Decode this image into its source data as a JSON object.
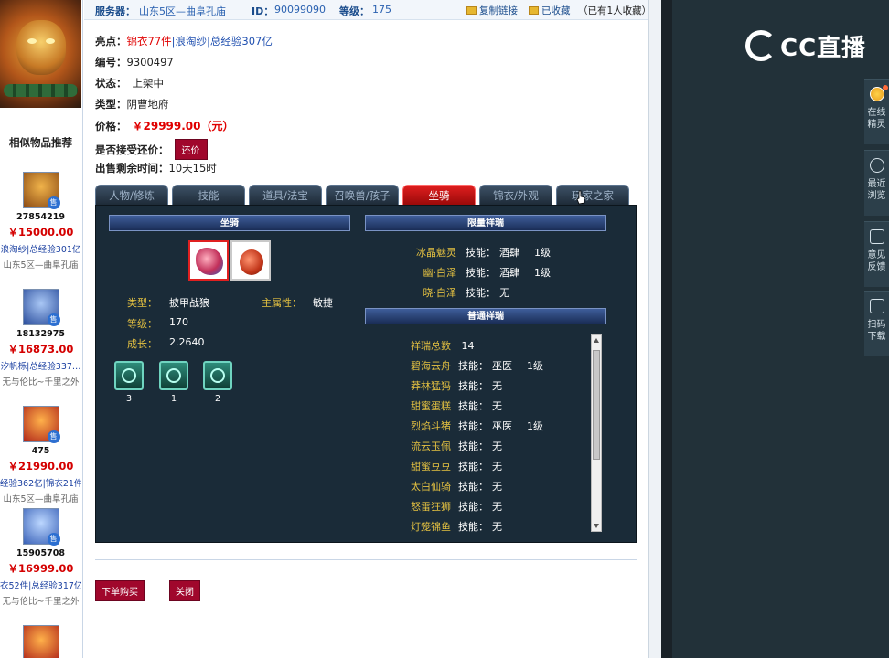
{
  "header": {
    "server_label": "服务器：",
    "server_value": "山东5区—曲阜孔庙",
    "id_label": "ID：",
    "id_value": "90099090",
    "level_label": "等级：",
    "level_value": "175",
    "copy_link": "复制链接",
    "favorited": "已收藏",
    "fav_count": "（已有1人收藏）"
  },
  "info": {
    "highlights_label": "亮点：",
    "highlights": [
      "锦衣77件",
      "浪淘纱",
      "总经验307亿"
    ],
    "number_label": "编号：",
    "number_value": "9300497",
    "status_label": "状态：",
    "status_value": "上架中",
    "type_label": "类型：",
    "type_value": "阴曹地府",
    "price_label": "价格：",
    "price_value": "￥29999.00（元）",
    "bargain_label": "是否接受还价：",
    "bargain_button": "还价",
    "remaining_label": "出售剩余时间：",
    "remaining_value": "10天15时"
  },
  "tabs": [
    {
      "label": "人物/修炼",
      "active": false
    },
    {
      "label": "技能",
      "active": false
    },
    {
      "label": "道具/法宝",
      "active": false
    },
    {
      "label": "召唤兽/孩子",
      "active": false
    },
    {
      "label": "坐骑",
      "active": true
    },
    {
      "label": "锦衣/外观",
      "active": false
    },
    {
      "label": "玩家之家",
      "active": false
    }
  ],
  "mount": {
    "section_title": "坐骑",
    "type_label": "类型：",
    "type_value": "披甲战狼",
    "main_attr_label": "主属性：",
    "main_attr_value": "敏捷",
    "level_label": "等级：",
    "level_value": "170",
    "growth_label": "成长：",
    "growth_value": "2.2640",
    "skills": [
      {
        "icon": "claw-skill-icon",
        "count": "3"
      },
      {
        "icon": "fist-skill-icon",
        "count": "1"
      },
      {
        "icon": "shield-skill-icon",
        "count": "2"
      }
    ]
  },
  "limited_xiangrui": {
    "title": "限量祥瑞",
    "rows": [
      {
        "name": "冰晶魅灵",
        "skill_label": "技能：",
        "skill": "酒肆",
        "level": "1级"
      },
      {
        "name": "幽·白泽",
        "skill_label": "技能：",
        "skill": "酒肆",
        "level": "1级"
      },
      {
        "name": "晓·白泽",
        "skill_label": "技能：",
        "skill": "无",
        "level": ""
      }
    ]
  },
  "common_xiangrui": {
    "title": "普通祥瑞",
    "total_label": "祥瑞总数",
    "total_value": "14",
    "rows": [
      {
        "name": "碧海云舟",
        "skill_label": "技能：",
        "skill": "巫医",
        "level": "1级"
      },
      {
        "name": "莽林猛犸",
        "skill_label": "技能：",
        "skill": "无",
        "level": ""
      },
      {
        "name": "甜蜜蛋糕",
        "skill_label": "技能：",
        "skill": "无",
        "level": ""
      },
      {
        "name": "烈焰斗猪",
        "skill_label": "技能：",
        "skill": "巫医",
        "level": "1级"
      },
      {
        "name": "流云玉佩",
        "skill_label": "技能：",
        "skill": "无",
        "level": ""
      },
      {
        "name": "甜蜜豆豆",
        "skill_label": "技能：",
        "skill": "无",
        "level": ""
      },
      {
        "name": "太白仙骑",
        "skill_label": "技能：",
        "skill": "无",
        "level": ""
      },
      {
        "name": "怒雷狂狮",
        "skill_label": "技能：",
        "skill": "无",
        "level": ""
      },
      {
        "name": "灯笼锦鱼",
        "skill_label": "技能：",
        "skill": "无",
        "level": ""
      }
    ]
  },
  "actions": {
    "buy": "下单购买",
    "close": "关闭"
  },
  "sidebar": {
    "title": "相似物品推荐",
    "items": [
      {
        "id": "27854219",
        "price": "￥15000.00",
        "tags": "浪淘纱|总经验301亿",
        "server": "山东5区—曲阜孔庙",
        "colors": {
          "a": "#f0b34a",
          "b": "#8b4a14"
        }
      },
      {
        "id": "18132975",
        "price": "￥16873.00",
        "tags": "汐帆栎|总经验337…",
        "server": "无与伦比~千里之外",
        "colors": {
          "a": "#a9c7f5",
          "b": "#2a4d9c"
        }
      },
      {
        "id": "475",
        "price": "￥21990.00",
        "tags": "经验362亿|锦衣21件",
        "server": "山东5区—曲阜孔庙",
        "colors": {
          "a": "#ffb14a",
          "b": "#b0261a"
        }
      },
      {
        "id": "15905708",
        "price": "￥16999.00",
        "tags": "衣52件|总经验317亿",
        "server": "无与伦比~千里之外",
        "colors": {
          "a": "#bcd7ff",
          "b": "#3a62b8"
        }
      }
    ]
  },
  "right_panel": {
    "logo_text": "CC直播",
    "buttons": [
      {
        "label": "在线精灵",
        "icon": "spirit-icon"
      },
      {
        "label": "最近浏览",
        "icon": "clock-icon"
      },
      {
        "label": "意见反馈",
        "icon": "edit-icon"
      },
      {
        "label": "扫码下载",
        "icon": "qr-icon"
      }
    ]
  }
}
